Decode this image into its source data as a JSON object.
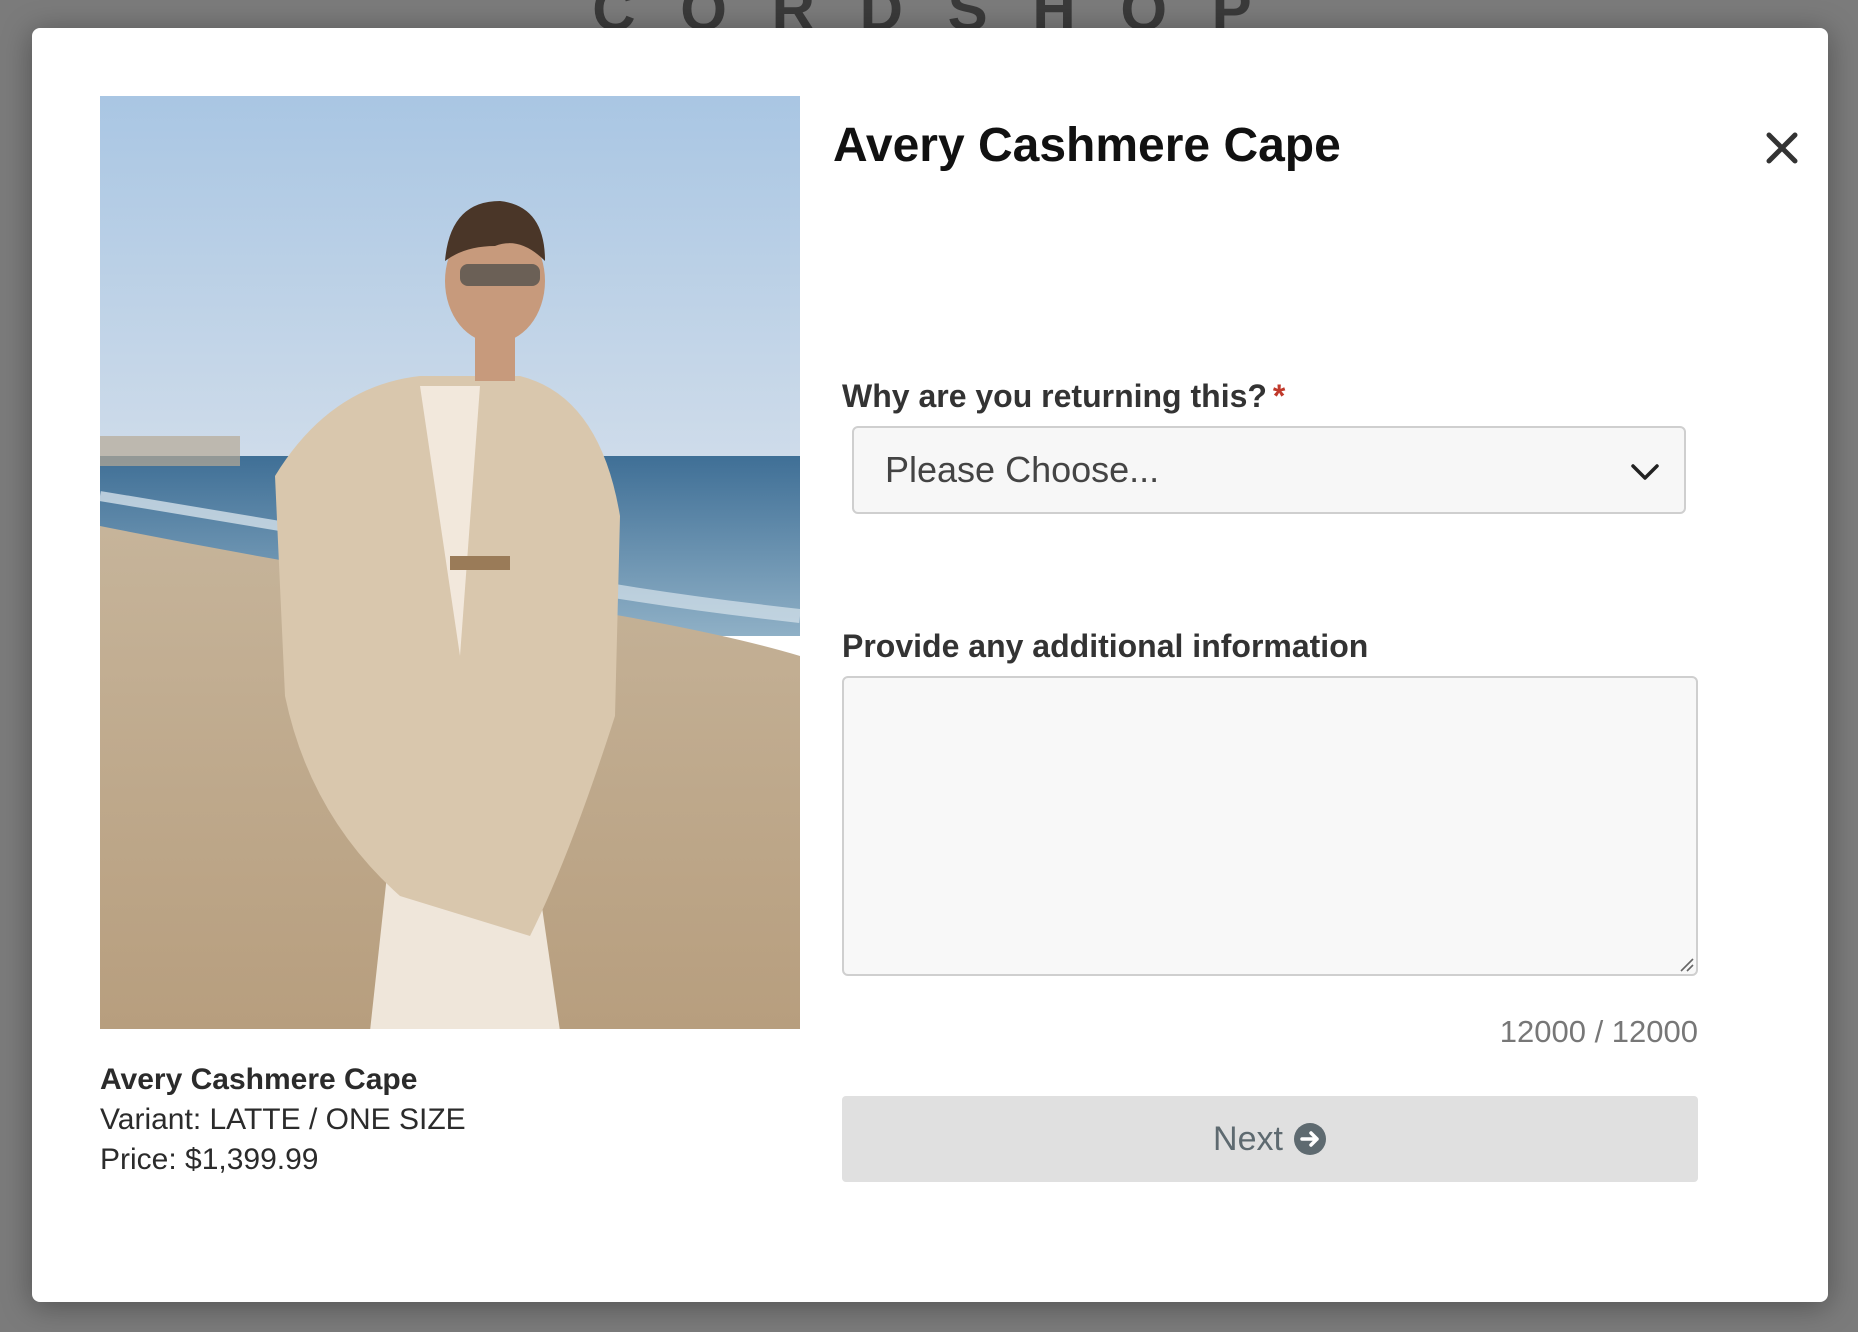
{
  "backdrop": {
    "title": "C O R D S H O P"
  },
  "modal": {
    "title": "Avery Cashmere Cape",
    "close_icon": "close-icon",
    "product": {
      "name": "Avery Cashmere Cape",
      "variant": "Variant: LATTE / ONE SIZE",
      "price": "Price: $1,399.99"
    },
    "reason": {
      "label": "Why are you returning this?",
      "required_mark": "*",
      "selected": "Please Choose..."
    },
    "details": {
      "label": "Provide any additional information",
      "value": "",
      "counter": "12000 / 12000"
    },
    "next_label": "Next",
    "colors": {
      "required": "#c0392b",
      "button_bg": "#e0e0e0",
      "button_text": "#5e6a70"
    }
  }
}
